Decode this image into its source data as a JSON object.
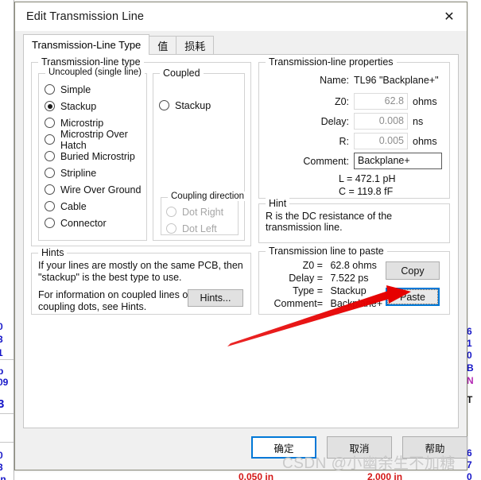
{
  "window": {
    "title": "Edit Transmission Line",
    "close_icon": "close-icon",
    "close_glyph": "✕"
  },
  "tabs": [
    {
      "label": "Transmission-Line Type",
      "active": true
    },
    {
      "label": "值",
      "active": false
    },
    {
      "label": "损耗",
      "active": false
    }
  ],
  "left": {
    "group_label": "Transmission-line type",
    "uncoupled": {
      "label": "Uncoupled  (single line)",
      "options": [
        {
          "label": "Simple",
          "checked": false,
          "disabled": false
        },
        {
          "label": "Stackup",
          "checked": true,
          "disabled": false
        },
        {
          "label": "Microstrip",
          "checked": false,
          "disabled": false
        },
        {
          "label": "Microstrip Over Hatch",
          "checked": false,
          "disabled": false
        },
        {
          "label": "Buried Microstrip",
          "checked": false,
          "disabled": false
        },
        {
          "label": "Stripline",
          "checked": false,
          "disabled": false
        },
        {
          "label": "Wire Over Ground",
          "checked": false,
          "disabled": false
        },
        {
          "label": "Cable",
          "checked": false,
          "disabled": false
        },
        {
          "label": "Connector",
          "checked": false,
          "disabled": false
        }
      ]
    },
    "coupled": {
      "label": "Coupled",
      "options": [
        {
          "label": "Stackup",
          "checked": false,
          "disabled": false
        }
      ],
      "direction": {
        "label": "Coupling direction",
        "options": [
          {
            "label": "Dot Right",
            "checked": false,
            "disabled": true
          },
          {
            "label": "Dot Left",
            "checked": false,
            "disabled": true
          }
        ]
      }
    },
    "hints": {
      "label": "Hints",
      "line1": "If your lines are mostly on the same PCB, then",
      "line2": "\"stackup\" is the best type to use.",
      "line3": "For information on coupled lines or",
      "line4": "coupling dots, see Hints.",
      "button": "Hints..."
    }
  },
  "right": {
    "properties": {
      "label": "Transmission-line properties",
      "name_label": "Name:",
      "name_value": "TL96 \"Backplane+\"",
      "z0_label": "Z0:",
      "z0_value": "62.8",
      "z0_unit": "ohms",
      "delay_label": "Delay:",
      "delay_value": "0.008",
      "delay_unit": "ns",
      "r_label": "R:",
      "r_value": "0.005",
      "r_unit": "ohms",
      "comment_label": "Comment:",
      "comment_value": "Backplane+",
      "l_line": "L =  472.1 pH",
      "c_line": "C =  119.8 fF"
    },
    "hint": {
      "label": "Hint",
      "text": "R is the DC resistance of the transmission line."
    },
    "paste": {
      "label": "Transmission line to paste",
      "z0_key": "Z0 =",
      "z0_value": "62.8 ohms",
      "delay_key": "Delay =",
      "delay_value": "7.522 ps",
      "type_key": "Type =",
      "type_value": "Stackup",
      "comment_key": "Comment=",
      "comment_value": "Backplane+",
      "copy_button": "Copy",
      "paste_button": "Paste"
    }
  },
  "footer": {
    "ok": "确定",
    "cancel": "取消",
    "help": "帮助"
  },
  "overlay": {
    "watermark": "CSDN @小幽余生不加糖",
    "arrow_color": "#e60000"
  },
  "background": {
    "left_fragments": [
      "0",
      "3",
      "1",
      "p",
      "09",
      "3",
      "0",
      "3",
      "in"
    ],
    "right_fragments": [
      "6",
      "1",
      "0",
      "B",
      "N",
      "T",
      "6",
      "7",
      "0"
    ],
    "bottom_red_left": "0.050 in",
    "bottom_red_right": "2.000 in"
  }
}
